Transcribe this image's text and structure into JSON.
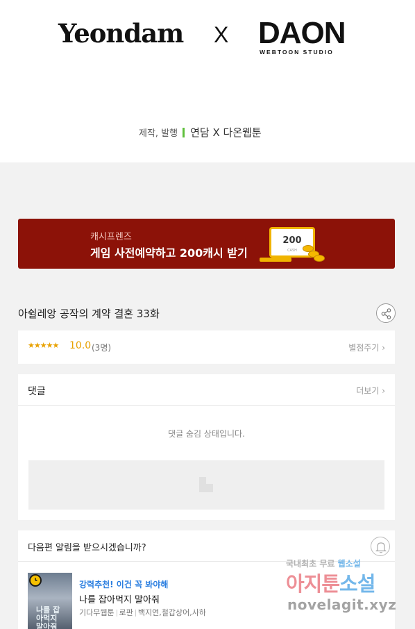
{
  "hero": {
    "logo_left": "Yeondam",
    "logo_x": "X",
    "logo_right": "DAON",
    "logo_right_sub": "WEBTOON STUDIO",
    "credit_role": "제작, 발행",
    "credit_studio": "연담 X 다온웹툰",
    "accent_color": "#5fbf3c"
  },
  "banner": {
    "subtitle": "캐시프렌즈",
    "title": "게임 사전예약하고 200캐시 받기",
    "card_amount": "200",
    "card_caption": "CASH",
    "bg_color": "#8c1208"
  },
  "episode": {
    "title": "아쉴레앙 공작의 계약 결혼 33화"
  },
  "rating": {
    "stars": "★★★★★",
    "value": "10.0",
    "count": "(3명)",
    "rate_link": "별점주기 ›"
  },
  "comments": {
    "title": "댓글",
    "more_link": "더보기 ›",
    "hidden_message": "댓글 숨김 상태입니다."
  },
  "alert": {
    "question": "다음편 알림을 받으시겠습니까?"
  },
  "recommendation": {
    "tag": "강력추천! 이건 꼭 봐야해",
    "title": "나를 잡아먹지 말아줘",
    "thumb_text": "나를 잡아먹지 말아줘",
    "meta": [
      "기다무웹툰",
      "로판",
      "백지연,철갑상어,사하"
    ]
  },
  "watermark": {
    "top_gray": "국내최초 무료 ",
    "top_highlight": "웹소설",
    "mid_red": "아지툰",
    "mid_highlight": "소설",
    "url": "novelagit.xyz"
  }
}
